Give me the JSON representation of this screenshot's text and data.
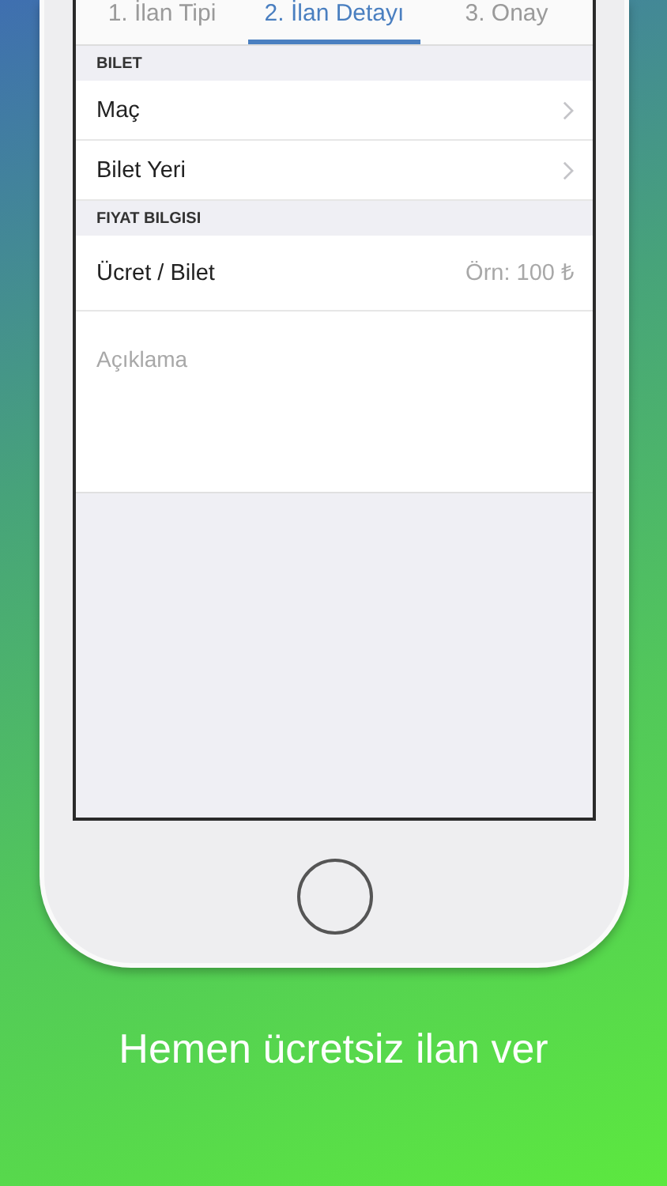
{
  "tabs": [
    {
      "label": "1. İlan Tipi",
      "selected": false
    },
    {
      "label": "2. İlan Detayı",
      "selected": true
    },
    {
      "label": "3. Onay",
      "selected": false
    }
  ],
  "sections": [
    {
      "header": "BILET",
      "rows": [
        {
          "kind": "link",
          "label": "Maç"
        },
        {
          "kind": "link",
          "label": "Bilet Yeri"
        }
      ]
    },
    {
      "header": "FIYAT BILGISI",
      "rows": [
        {
          "kind": "input",
          "label": "Ücret / Bilet",
          "placeholder": "Örn: 100 ₺"
        },
        {
          "kind": "textarea",
          "placeholder": "Açıklama"
        }
      ]
    }
  ],
  "caption": "Hemen ücretsiz ilan ver"
}
